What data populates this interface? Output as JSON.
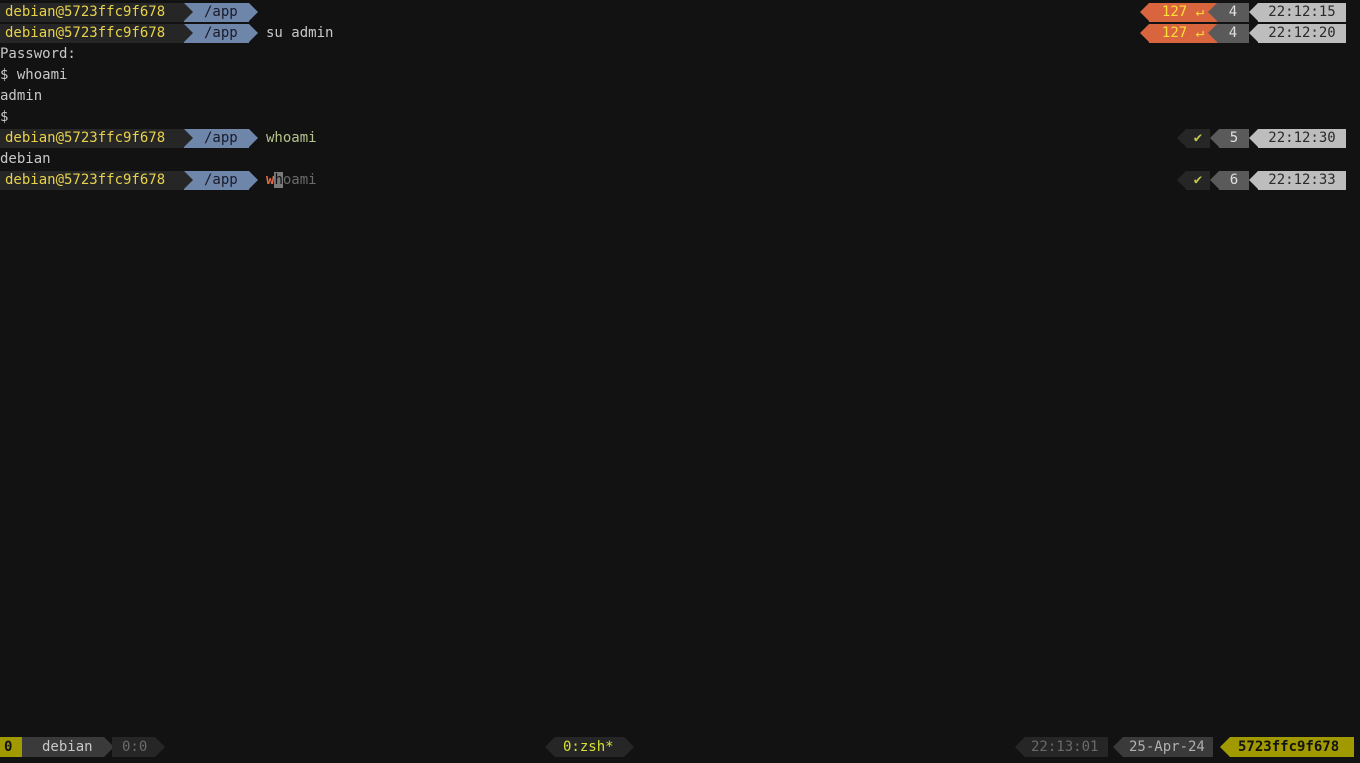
{
  "prompt": {
    "user_host": "debian@5723ffc9f678",
    "dir": "/app"
  },
  "lines": [
    {
      "cmd": "",
      "status": "127 ↵",
      "jobs": "4",
      "time": "22:12:15"
    },
    {
      "cmd": "su admin",
      "status": "127 ↵",
      "jobs": "4",
      "time": "22:12:20"
    },
    {
      "cmd": "whoami",
      "status": "✔",
      "jobs": "5",
      "time": "22:12:30"
    },
    {
      "cmd_typed": "w",
      "cmd_cursor": "h",
      "cmd_ghost": "oami",
      "status": "✔",
      "jobs": "6",
      "time": "22:12:33"
    }
  ],
  "output": {
    "password_prompt": "Password:",
    "shell_whoami": "$ whoami",
    "admin_result": "admin",
    "shell_prompt": "$",
    "debian_result": "debian"
  },
  "statusbar": {
    "session": "0",
    "host_label": "debian",
    "pane": "0:0",
    "window": "0:zsh*",
    "clock": "22:13:01",
    "date": "25-Apr-24",
    "hostname": "5723ffc9f678"
  },
  "colors": {
    "background": "#121212",
    "prompt_user": "#e8d24a",
    "dir_bg": "#6e86aa",
    "error_bg": "#d9653e",
    "tmux_accent": "#a09a00"
  }
}
